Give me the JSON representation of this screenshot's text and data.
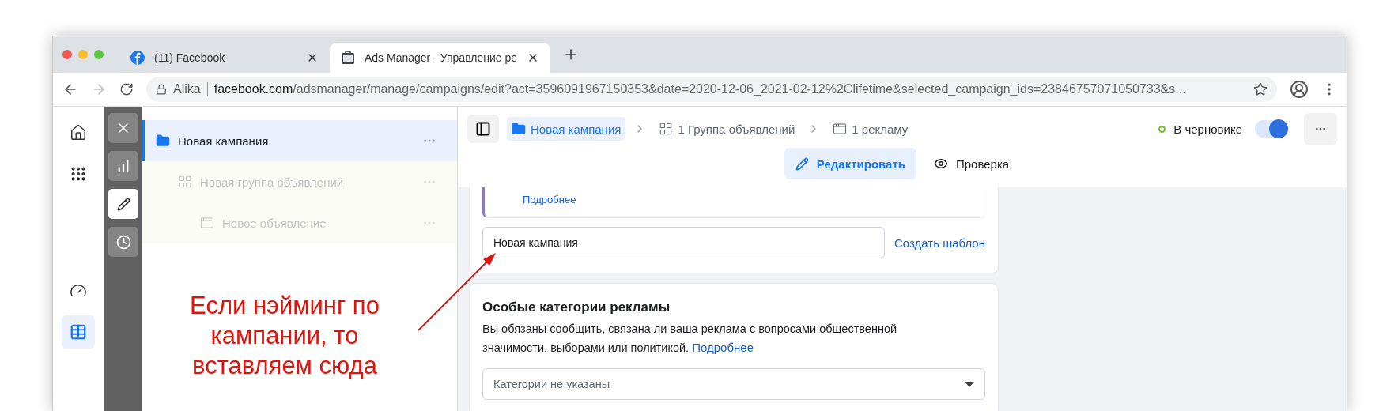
{
  "browser": {
    "tabs": [
      {
        "kind": "facebook",
        "title": "(11) Facebook",
        "selected": false
      },
      {
        "kind": "ads",
        "title": "Ads Manager - Управление ре",
        "selected": true
      }
    ],
    "address": {
      "account": "Alika",
      "host": "facebook.com",
      "path": "/adsmanager/manage/campaigns/edit?act=3596091967150353&date=2020-12-06_2021-02-12%2Clifetime&selected_campaign_ids=23846757071050733&s..."
    }
  },
  "nav_rail": [
    {
      "kind": "home",
      "selected": false
    },
    {
      "kind": "apps",
      "selected": false
    },
    {
      "kind": "gauge",
      "selected": false
    },
    {
      "kind": "table",
      "selected": true
    }
  ],
  "tool_strip": [
    {
      "kind": "close",
      "selected": false
    },
    {
      "kind": "chart",
      "selected": false
    },
    {
      "kind": "edit",
      "selected": true
    },
    {
      "kind": "history",
      "selected": false
    }
  ],
  "tree": [
    {
      "kind": "campaign",
      "label": "Новая кампания",
      "selected": true,
      "dimmed": false,
      "children": [
        {
          "kind": "adset",
          "label": "Новая группа объявлений",
          "selected": false,
          "dimmed": true,
          "children": [
            {
              "kind": "ad",
              "label": "Новое объявление",
              "selected": false,
              "dimmed": true
            }
          ]
        }
      ]
    }
  ],
  "breadcrumbs": [
    {
      "kind": "campaign",
      "label": "Новая кампания",
      "selected": true
    },
    {
      "kind": "adset",
      "label": "1 Группа объявлений",
      "selected": false
    },
    {
      "kind": "ad",
      "label": "1 рекламу",
      "selected": false
    }
  ],
  "status": {
    "label": "В черновике",
    "color": "#6cbf2e",
    "on": true
  },
  "modes": [
    {
      "kind": "edit",
      "label": "Редактировать",
      "selected": true
    },
    {
      "kind": "review",
      "label": "Проверка",
      "selected": false
    }
  ],
  "name_card": {
    "notice_link": "Подробнее",
    "name_value": "Новая кампания",
    "template_link": "Создать шаблон"
  },
  "special_card": {
    "title": "Особые категории рекламы",
    "description": "Вы обязаны сообщить, связана ли ваша реклама с вопросами общественной значимости, выборами или политикой.",
    "link": "Подробнее",
    "select_placeholder": "Категории не указаны"
  },
  "annotation": {
    "text": "Если нэйминг по кампании, то вставляем сюда"
  }
}
